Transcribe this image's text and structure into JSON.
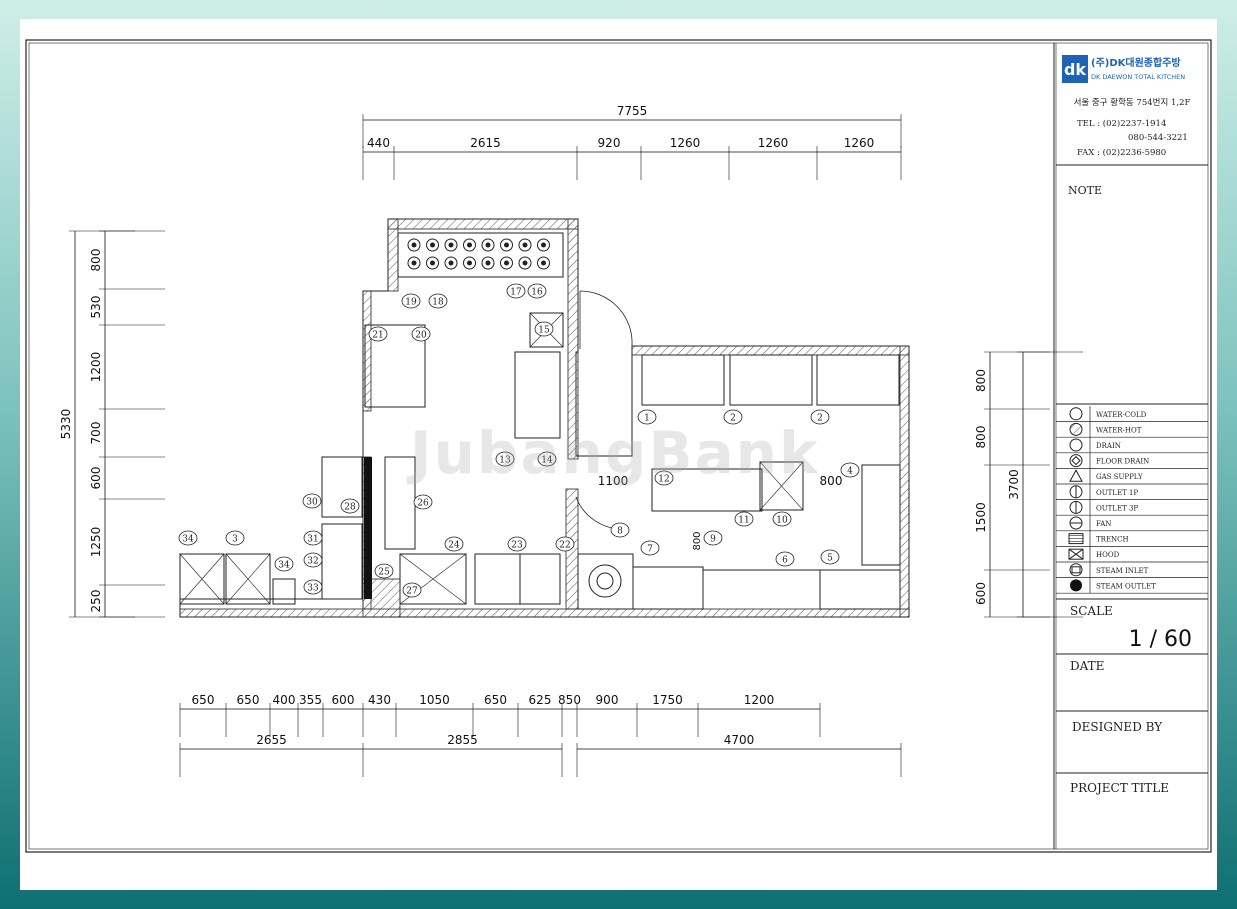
{
  "company": {
    "logo_letters": "dk",
    "name_ko": "(주)DK대원종합주방",
    "name_en": "DK DAEWON TOTAL KITCHEN",
    "address": "서울 중구 황학동 754번지 1,2F",
    "tel": "TEL : (02)2237-1914",
    "tel2": "080-544-3221",
    "fax": "FAX : (02)2236-5980"
  },
  "title_block": {
    "note_label": "NOTE",
    "scale_label": "SCALE",
    "scale_value": "1 / 60",
    "date_label": "DATE",
    "designed_by_label": "DESIGNED BY",
    "project_title_label": "PROJECT TITLE"
  },
  "legend": [
    {
      "symbol": "circle",
      "label": "WATER-COLD"
    },
    {
      "symbol": "hatched-circle",
      "label": "WATER-HOT"
    },
    {
      "symbol": "hex",
      "label": "DRAIN"
    },
    {
      "symbol": "diamond-circle",
      "label": "FLOOR DRAIN"
    },
    {
      "symbol": "triangle",
      "label": "GAS SUPPLY"
    },
    {
      "symbol": "circle-vline",
      "label": "OUTLET 1P"
    },
    {
      "symbol": "circle-vline",
      "label": "OUTLET 3P"
    },
    {
      "symbol": "circle-hline",
      "label": "FAN"
    },
    {
      "symbol": "lines",
      "label": "TRENCH"
    },
    {
      "symbol": "x-box",
      "label": "HOOD"
    },
    {
      "symbol": "box-circle",
      "label": "STEAM INLET"
    },
    {
      "symbol": "filled-hex",
      "label": "STEAM OUTLET"
    }
  ],
  "dimensions": {
    "top_total": "7755",
    "top_segments": [
      "440",
      "2615",
      "920",
      "1260",
      "1260",
      "1260"
    ],
    "left_total": "5330",
    "left_segments": [
      "800",
      "530",
      "1200",
      "700",
      "600",
      "1250",
      "250"
    ],
    "right_total": "3700",
    "right_segments": [
      "800",
      "800",
      "1500",
      "600"
    ],
    "bottom_segments": [
      "650",
      "650",
      "400",
      "355",
      "600",
      "430",
      "1050",
      "650",
      "625",
      "850",
      "900",
      "1750",
      "1200"
    ],
    "bottom_totals": [
      "2655",
      "2855",
      "4700"
    ],
    "inner": [
      "1100",
      "800",
      "800"
    ]
  },
  "equipment_numbers": [
    "1",
    "2",
    "2",
    "3",
    "4",
    "5",
    "6",
    "7",
    "8",
    "9",
    "10",
    "11",
    "12",
    "13",
    "14",
    "15",
    "16",
    "17",
    "18",
    "19",
    "20",
    "21",
    "22",
    "23",
    "24",
    "25",
    "26",
    "27",
    "28",
    "29",
    "30",
    "31",
    "32",
    "33",
    "34",
    "34"
  ],
  "watermark": "JubangBank"
}
